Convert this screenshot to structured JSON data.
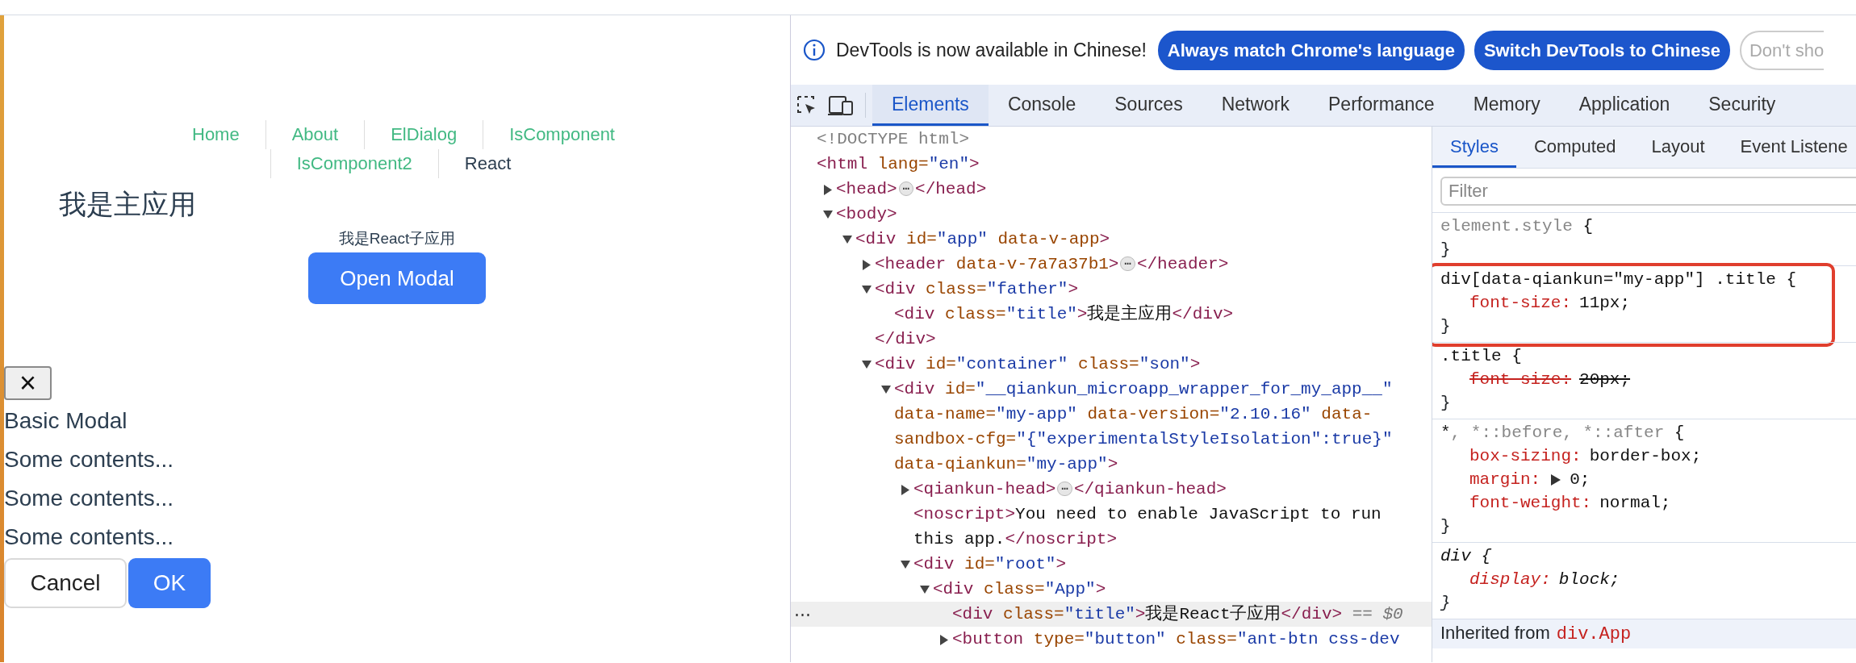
{
  "app": {
    "nav": [
      {
        "label": "Home",
        "active": false
      },
      {
        "label": "About",
        "active": false
      },
      {
        "label": "ElDialog",
        "active": false
      },
      {
        "label": "IsComponent",
        "active": false
      },
      {
        "label": "IsComponent2",
        "active": false
      },
      {
        "label": "React",
        "active": true
      }
    ],
    "title": "我是主应用",
    "sub_title": "我是React子应用",
    "open_button": "Open Modal",
    "modal": {
      "close": "×",
      "title": "Basic Modal",
      "contents": [
        "Some contents...",
        "Some contents...",
        "Some contents..."
      ],
      "cancel": "Cancel",
      "ok": "OK"
    }
  },
  "devtools": {
    "notice": {
      "text": "DevTools is now available in Chinese!",
      "buttons": [
        {
          "label": "Always match Chrome's language",
          "kind": "primary"
        },
        {
          "label": "Switch DevTools to Chinese",
          "kind": "primary"
        },
        {
          "label": "Don't sho",
          "kind": "outline"
        }
      ]
    },
    "tabs": [
      {
        "label": "Elements",
        "selected": true
      },
      {
        "label": "Console",
        "selected": false
      },
      {
        "label": "Sources",
        "selected": false
      },
      {
        "label": "Network",
        "selected": false
      },
      {
        "label": "Performance",
        "selected": false
      },
      {
        "label": "Memory",
        "selected": false
      },
      {
        "label": "Application",
        "selected": false
      },
      {
        "label": "Security",
        "selected": false
      }
    ],
    "dom": [
      {
        "lines": [
          [
            {
              "kind": "doctype",
              "text": "<!DOCTYPE html>"
            }
          ]
        ]
      },
      {
        "lines": [
          [
            {
              "kind": "tag",
              "text": "<html"
            },
            {
              "kind": "attr",
              "text": " lang="
            },
            {
              "kind": "val",
              "text": "\"en\""
            },
            {
              "kind": "tag",
              "text": ">"
            }
          ]
        ],
        "children": [
          {
            "expanded": false,
            "lines": [
              [
                {
                  "kind": "tag",
                  "text": "<head>"
                },
                {
                  "kind": "more",
                  "text": "⋯"
                },
                {
                  "kind": "tag",
                  "text": "</head>"
                }
              ]
            ]
          },
          {
            "expanded": true,
            "lines": [
              [
                {
                  "kind": "tag",
                  "text": "<body>"
                }
              ]
            ],
            "children": [
              {
                "expanded": true,
                "lines": [
                  [
                    {
                      "kind": "tag",
                      "text": "<div"
                    },
                    {
                      "kind": "attr",
                      "text": " id="
                    },
                    {
                      "kind": "val",
                      "text": "\"app\""
                    },
                    {
                      "kind": "attr",
                      "text": " data-v-app"
                    },
                    {
                      "kind": "tag",
                      "text": ">"
                    }
                  ]
                ],
                "children": [
                  {
                    "expanded": false,
                    "lines": [
                      [
                        {
                          "kind": "tag",
                          "text": "<header"
                        },
                        {
                          "kind": "attr",
                          "text": " data-v-7a7a37b1"
                        },
                        {
                          "kind": "tag",
                          "text": ">"
                        },
                        {
                          "kind": "more",
                          "text": "⋯"
                        },
                        {
                          "kind": "tag",
                          "text": "</header>"
                        }
                      ]
                    ]
                  },
                  {
                    "expanded": true,
                    "lines": [
                      [
                        {
                          "kind": "tag",
                          "text": "<div"
                        },
                        {
                          "kind": "attr",
                          "text": " class="
                        },
                        {
                          "kind": "val",
                          "text": "\"father\""
                        },
                        {
                          "kind": "tag",
                          "text": ">"
                        }
                      ]
                    ],
                    "children": [
                      {
                        "lines": [
                          [
                            {
                              "kind": "tag",
                              "text": "<div"
                            },
                            {
                              "kind": "attr",
                              "text": " class="
                            },
                            {
                              "kind": "val",
                              "text": "\"title\""
                            },
                            {
                              "kind": "tag",
                              "text": ">"
                            },
                            {
                              "kind": "text",
                              "text": "我是主应用"
                            },
                            {
                              "kind": "tag",
                              "text": "</div>"
                            }
                          ]
                        ]
                      }
                    ],
                    "closing": [
                      {
                        "kind": "tag",
                        "text": "</div>"
                      }
                    ]
                  },
                  {
                    "expanded": true,
                    "lines": [
                      [
                        {
                          "kind": "tag",
                          "text": "<div"
                        },
                        {
                          "kind": "attr",
                          "text": " id="
                        },
                        {
                          "kind": "val",
                          "text": "\"container\""
                        },
                        {
                          "kind": "attr",
                          "text": " class="
                        },
                        {
                          "kind": "val",
                          "text": "\"son\""
                        },
                        {
                          "kind": "tag",
                          "text": ">"
                        }
                      ]
                    ],
                    "children": [
                      {
                        "expanded": true,
                        "lines": [
                          [
                            {
                              "kind": "tag",
                              "text": "<div"
                            },
                            {
                              "kind": "attr",
                              "text": " id="
                            },
                            {
                              "kind": "val",
                              "text": "\"__qiankun_microapp_wrapper_for_my_app__\""
                            }
                          ],
                          [
                            {
                              "kind": "attr",
                              "text": "data-name="
                            },
                            {
                              "kind": "val",
                              "text": "\"my-app\""
                            },
                            {
                              "kind": "attr",
                              "text": " data-version="
                            },
                            {
                              "kind": "val",
                              "text": "\"2.10.16\""
                            },
                            {
                              "kind": "attr",
                              "text": " data-"
                            }
                          ],
                          [
                            {
                              "kind": "attr",
                              "text": "sandbox-cfg="
                            },
                            {
                              "kind": "val",
                              "text": "\"{\"experimentalStyleIsolation\":true}\""
                            }
                          ],
                          [
                            {
                              "kind": "attr",
                              "text": "data-qiankun="
                            },
                            {
                              "kind": "val",
                              "text": "\"my-app\""
                            },
                            {
                              "kind": "tag",
                              "text": ">"
                            }
                          ]
                        ],
                        "children": [
                          {
                            "expanded": false,
                            "lines": [
                              [
                                {
                                  "kind": "tag",
                                  "text": "<qiankun-head>"
                                },
                                {
                                  "kind": "more",
                                  "text": "⋯"
                                },
                                {
                                  "kind": "tag",
                                  "text": "</qiankun-head>"
                                }
                              ]
                            ]
                          },
                          {
                            "lines": [
                              [
                                {
                                  "kind": "tag",
                                  "text": "<noscript>"
                                },
                                {
                                  "kind": "text",
                                  "text": "You need to enable JavaScript to run"
                                }
                              ],
                              [
                                {
                                  "kind": "text",
                                  "text": "this app."
                                },
                                {
                                  "kind": "tag",
                                  "text": "</noscript>"
                                }
                              ]
                            ]
                          },
                          {
                            "expanded": true,
                            "lines": [
                              [
                                {
                                  "kind": "tag",
                                  "text": "<div"
                                },
                                {
                                  "kind": "attr",
                                  "text": " id="
                                },
                                {
                                  "kind": "val",
                                  "text": "\"root\""
                                },
                                {
                                  "kind": "tag",
                                  "text": ">"
                                }
                              ]
                            ],
                            "children": [
                              {
                                "expanded": true,
                                "lines": [
                                  [
                                    {
                                      "kind": "tag",
                                      "text": "<div"
                                    },
                                    {
                                      "kind": "attr",
                                      "text": " class="
                                    },
                                    {
                                      "kind": "val",
                                      "text": "\"App\""
                                    },
                                    {
                                      "kind": "tag",
                                      "text": ">"
                                    }
                                  ]
                                ],
                                "children": [
                                  {
                                    "selected": true,
                                    "gutter": "⋯",
                                    "lines": [
                                      [
                                        {
                                          "kind": "tag",
                                          "text": "<div"
                                        },
                                        {
                                          "kind": "attr",
                                          "text": " class="
                                        },
                                        {
                                          "kind": "val",
                                          "text": "\"title\""
                                        },
                                        {
                                          "kind": "tag",
                                          "text": ">"
                                        },
                                        {
                                          "kind": "text",
                                          "text": "我是React子应用"
                                        },
                                        {
                                          "kind": "tag",
                                          "text": "</div>"
                                        },
                                        {
                                          "kind": "dim",
                                          "text": " == $0"
                                        }
                                      ]
                                    ]
                                  },
                                  {
                                    "expanded": false,
                                    "lines": [
                                      [
                                        {
                                          "kind": "tag",
                                          "text": "<button"
                                        },
                                        {
                                          "kind": "attr",
                                          "text": " type="
                                        },
                                        {
                                          "kind": "val",
                                          "text": "\"button\""
                                        },
                                        {
                                          "kind": "attr",
                                          "text": " class="
                                        },
                                        {
                                          "kind": "val",
                                          "text": "\"ant-btn css-dev"
                                        }
                                      ]
                                    ]
                                  }
                                ]
                              }
                            ]
                          }
                        ]
                      }
                    ]
                  }
                ]
              }
            ]
          }
        ]
      }
    ],
    "styles": {
      "tabs": [
        {
          "label": "Styles",
          "selected": true
        },
        {
          "label": "Computed",
          "selected": false
        },
        {
          "label": "Layout",
          "selected": false
        },
        {
          "label": "Event Listene",
          "selected": false
        }
      ],
      "filter": {
        "placeholder": "Filter"
      },
      "rules": [
        {
          "selector": [
            {
              "kind": "dim",
              "text": "element.style"
            },
            {
              "kind": "sel",
              "text": " {"
            }
          ],
          "close": "}",
          "highlighted": false,
          "user_agent": false
        },
        {
          "selector": [
            {
              "kind": "sel",
              "text": "div[data-qiankun=\"my-app\"] .title {"
            }
          ],
          "properties": [
            {
              "name": "font-size:",
              "value": "11px;",
              "overridden": false,
              "expandable": false
            }
          ],
          "close": "}",
          "highlighted": true,
          "user_agent": false
        },
        {
          "selector": [
            {
              "kind": "sel",
              "text": ".title {"
            }
          ],
          "properties": [
            {
              "name": "font-size:",
              "value": "20px;",
              "overridden": true,
              "expandable": false
            }
          ],
          "close": "}",
          "highlighted": false,
          "user_agent": false
        },
        {
          "selector": [
            {
              "kind": "sel",
              "text": "*"
            },
            {
              "kind": "dim",
              "text": ", *::before, *::after"
            },
            {
              "kind": "sel",
              "text": " {"
            }
          ],
          "properties": [
            {
              "name": "box-sizing:",
              "value": "border-box;",
              "overridden": false,
              "expandable": false
            },
            {
              "name": "margin:",
              "value": "0;",
              "overridden": false,
              "expandable": true
            },
            {
              "name": "font-weight:",
              "value": "normal;",
              "overridden": false,
              "expandable": false
            }
          ],
          "close": "}",
          "highlighted": false,
          "user_agent": false
        },
        {
          "selector": [
            {
              "kind": "sel",
              "text": "div {"
            }
          ],
          "properties": [
            {
              "name": "display:",
              "value": "block;",
              "overridden": false,
              "expandable": false
            }
          ],
          "close": "}",
          "highlighted": false,
          "user_agent": true
        }
      ],
      "inherited": {
        "label": "Inherited from",
        "selector": "div.App"
      }
    }
  }
}
